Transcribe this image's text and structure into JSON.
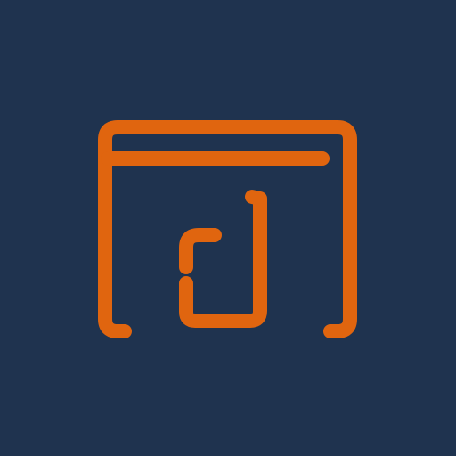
{
  "app_icon": {
    "icon": "browser-window-d-logo-icon",
    "colors": {
      "background": "#1F334F",
      "accent": "#E0650F"
    }
  }
}
